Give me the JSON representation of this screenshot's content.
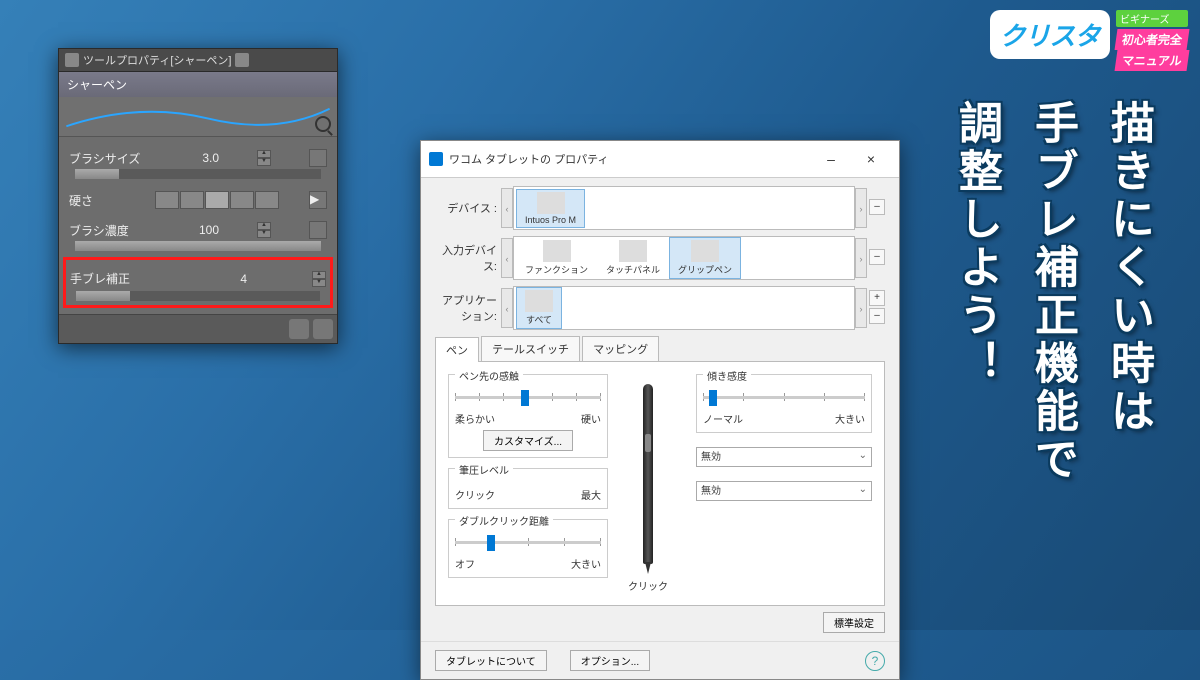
{
  "logo": {
    "main": "クリスタ",
    "tag": "ビギナーズ",
    "sub1": "初心者完全",
    "sub2": "マニュアル"
  },
  "headline": {
    "l1": "描きにくい時は",
    "l2": "手ブレ補正機能で",
    "l3": "調整しよう！"
  },
  "csp": {
    "title": "ツールプロパティ[シャーペン]",
    "sub": "シャーペン",
    "brush_size_label": "ブラシサイズ",
    "brush_size_val": "3.0",
    "hardness_label": "硬さ",
    "density_label": "ブラシ濃度",
    "density_val": "100",
    "stab_label": "手ブレ補正",
    "stab_val": "4"
  },
  "wacom": {
    "title": "ワコム タブレットの プロパティ",
    "device_label": "デバイス :",
    "device_item": "Intuos Pro M",
    "input_label": "入力デバイス:",
    "input_items": [
      "ファンクション",
      "タッチパネル",
      "グリップペン"
    ],
    "app_label": "アプリケーション:",
    "app_item": "すべて",
    "tabs": [
      "ペン",
      "テールスイッチ",
      "マッピング"
    ],
    "tip_feel": "ペン先の感触",
    "tip_soft": "柔らかい",
    "tip_hard": "硬い",
    "customize": "カスタマイズ...",
    "pressure": "筆圧レベル",
    "click": "クリック",
    "max": "最大",
    "dbl": "ダブルクリック距離",
    "off": "オフ",
    "big": "大きい",
    "tilt": "傾き感度",
    "normal": "ノーマル",
    "disabled": "無効",
    "pen_click": "クリック",
    "default": "標準設定",
    "about": "タブレットについて",
    "options": "オプション...",
    "minus": "–",
    "close": "×",
    "plus": "+"
  }
}
